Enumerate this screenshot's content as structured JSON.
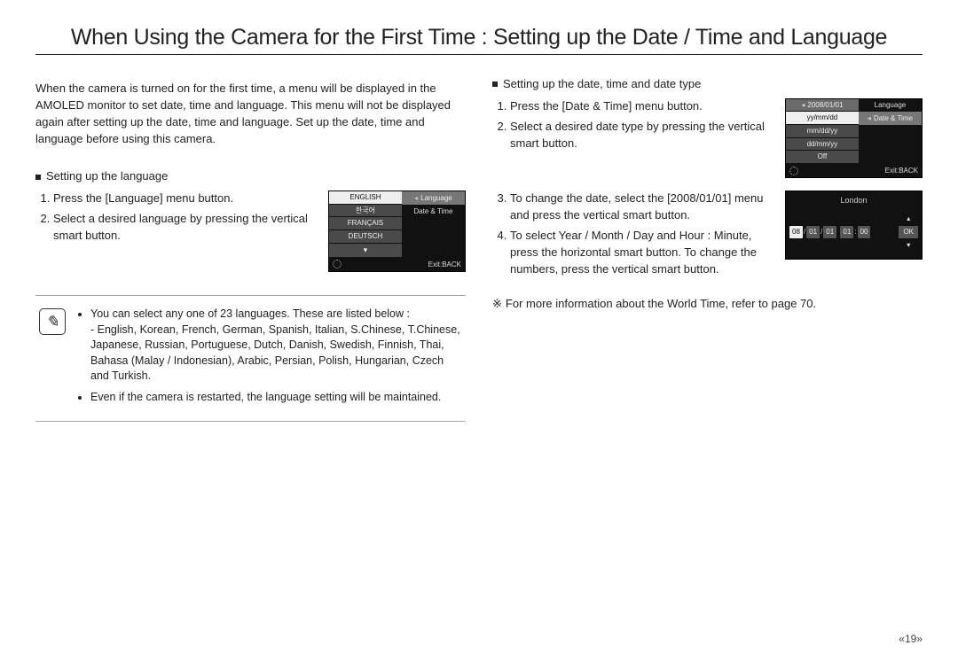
{
  "title": "When Using the Camera for the First Time : Setting up the Date / Time and Language",
  "intro": "When the camera is turned on for the first time, a menu will be displayed in the AMOLED monitor to set date, time and language. This menu will not be displayed again after setting up the date, time and language. Set up the date, time and language before using this camera.",
  "left": {
    "heading": "Setting up the language",
    "step1": "Press the [Language] menu button.",
    "step2": "Select a desired language by pressing the vertical smart button."
  },
  "lcd_lang": {
    "list_up": "▴",
    "opt1": "ENGLISH",
    "opt2": "한국어",
    "opt3": "FRANÇAIS",
    "opt4": "DEUTSCH",
    "list_down": "▾",
    "side1": "Language",
    "side2": "Date & Time",
    "exit": "Exit:BACK"
  },
  "note": {
    "b1_intro": "You can select any one of 23 languages. These are listed below :",
    "b1_langs": "- English, Korean, French, German, Spanish, Italian, S.Chinese, T.Chinese, Japanese, Russian, Portuguese, Dutch, Danish, Swedish, Finnish, Thai, Bahasa (Malay / Indonesian), Arabic, Persian, Polish, Hungarian, Czech and Turkish.",
    "b2": "Even if the camera is restarted, the language setting will be maintained."
  },
  "right": {
    "heading": "Setting up the date, time and date type",
    "step1": "Press the [Date & Time] menu button.",
    "step2": "Select a desired date type by pressing the vertical smart button.",
    "step3": "To change the date, select the [2008/01/01] menu and press the vertical smart button.",
    "step4": "To select Year / Month / Day and Hour : Minute, press the horizontal smart button. To change the numbers, press the vertical smart button."
  },
  "lcd_type": {
    "opt1": "2008/01/01",
    "opt2": "yy/mm/dd",
    "opt3": "mm/dd/yy",
    "opt4": "dd/mm/yy",
    "opt5": "Off",
    "side1": "Language",
    "side2": "Date & Time",
    "exit": "Exit:BACK"
  },
  "lcd_date": {
    "city": "London",
    "y": "08",
    "m": "01",
    "d": "01",
    "h": "01",
    "min": "00",
    "ok": "OK",
    "up": "▴",
    "down": "▾"
  },
  "footnote": "For more information about the World Time, refer to page 70.",
  "footnote_sym": "※",
  "page_num": "«19»"
}
